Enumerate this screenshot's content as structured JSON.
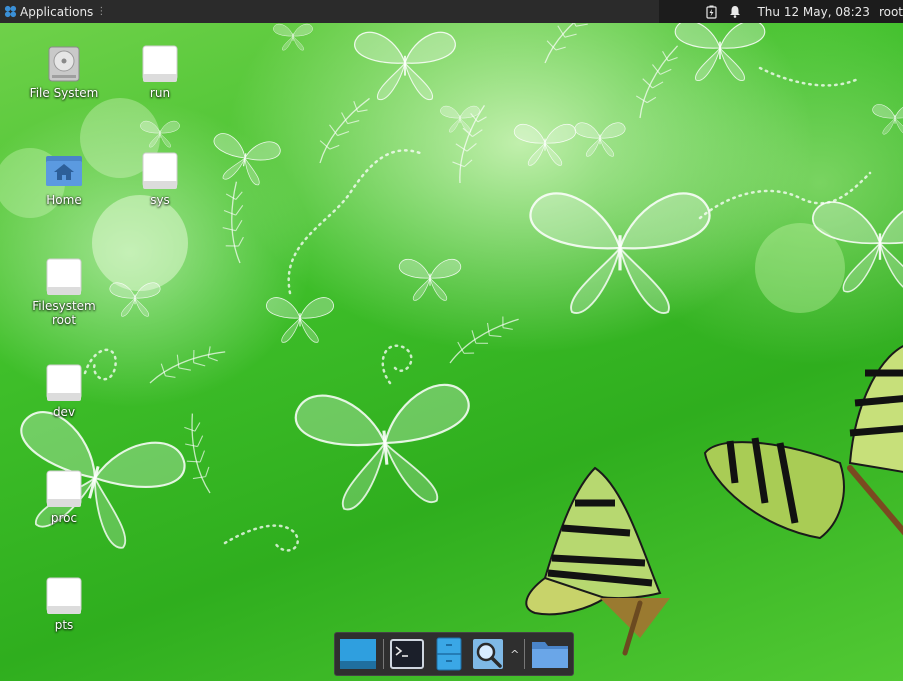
{
  "top_panel": {
    "apps_label": "Applications",
    "apps_grip": "⋮",
    "clock": "Thu 12 May, 08:23",
    "user": "root",
    "icons": [
      "applications-logo-icon",
      "battery-charging-icon",
      "notification-bell-icon"
    ]
  },
  "desktop": {
    "icons": [
      {
        "label": "File System",
        "icon": "hard-drive-icon"
      },
      {
        "label": "run",
        "icon": "drive-icon"
      },
      {
        "label": "Home",
        "icon": "home-folder-icon"
      },
      {
        "label": "sys",
        "icon": "drive-icon"
      },
      {
        "label": "Filesystem root",
        "icon": "drive-icon"
      },
      {
        "label": "dev",
        "icon": "drive-icon"
      },
      {
        "label": "proc",
        "icon": "drive-icon"
      },
      {
        "label": "pts",
        "icon": "drive-icon"
      }
    ]
  },
  "dock": {
    "items": [
      "show-desktop-icon",
      "terminal-icon",
      "file-manager-icon",
      "search-icon",
      "folder-icon"
    ],
    "caret": "^"
  },
  "colors": {
    "panel_bg": "#2b2b2b",
    "wallpaper_green": "#3fbf2a",
    "dock_bg": "#2f2f2f",
    "accent_blue": "#2f9fdf"
  }
}
